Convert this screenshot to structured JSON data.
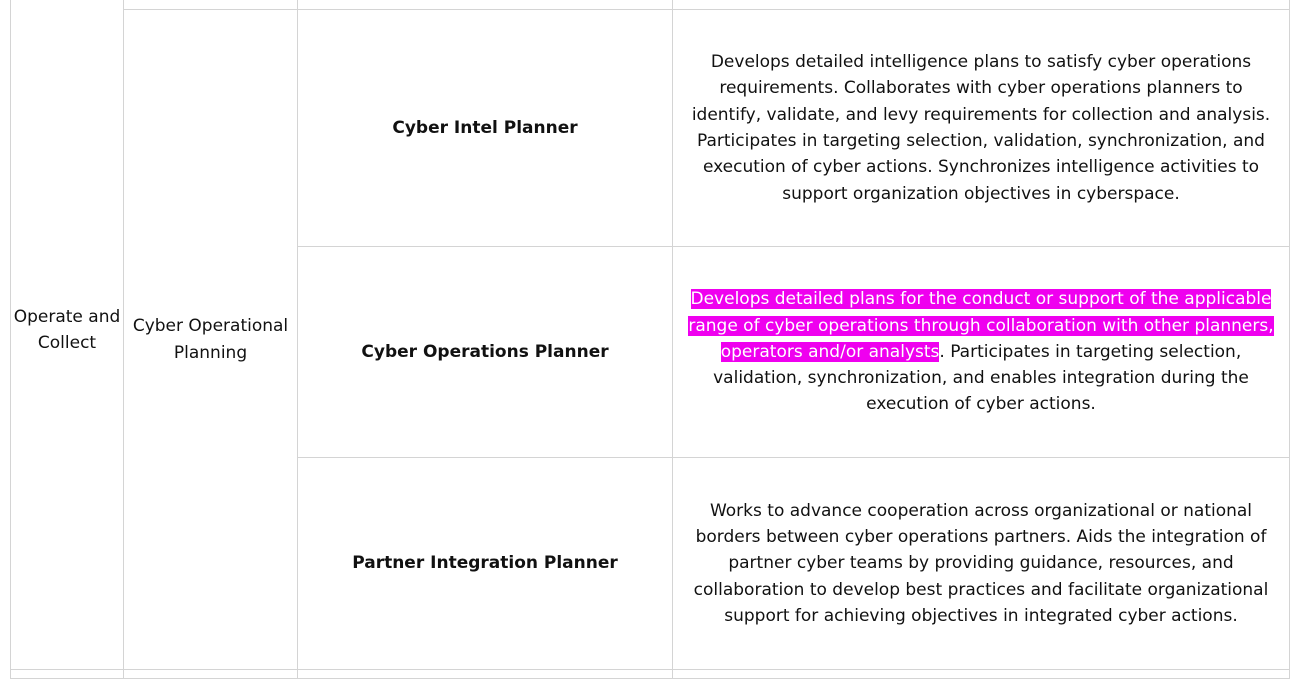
{
  "category": "Operate and Collect",
  "specialty_area": "Cyber Operational Planning",
  "roles": [
    {
      "title": "Cyber Intel Planner",
      "description": "Develops detailed intelligence plans to satisfy cyber operations requirements.  Collaborates with cyber operations planners to identify, validate, and levy requirements for collection and analysis.  Participates in targeting selection, validation, synchronization, and execution of cyber actions.  Synchronizes intelligence activities to support organization objectives in cyberspace."
    },
    {
      "title": "Cyber Operations Planner",
      "description_highlighted": "Develops detailed plans for the conduct or support of the applicable range of cyber operations through collaboration with other planners, operators and/or analysts",
      "description_rest": ".   Participates in targeting selection, validation, synchronization, and enables integration during the execution of cyber actions.",
      "highlight_color": "#ef00ef"
    },
    {
      "title": "Partner Integration Planner",
      "description": "Works to advance cooperation across organizational or national borders between cyber operations partners.  Aids the integration of partner cyber teams by providing guidance, resources, and collaboration to develop best practices and facilitate organizational support for achieving objectives in integrated cyber actions."
    }
  ]
}
